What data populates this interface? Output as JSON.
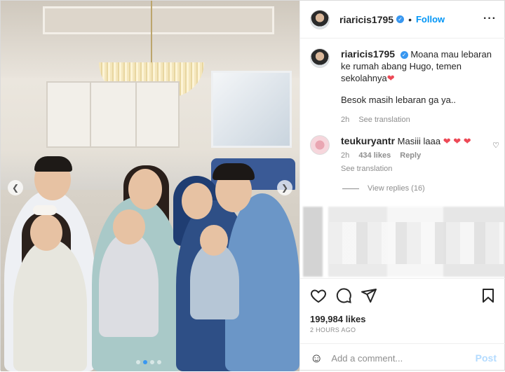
{
  "post": {
    "username": "riaricis1795",
    "verified_icon": "verified-badge-icon",
    "separator": "•",
    "follow_label": "Follow",
    "more_icon": "more-options-icon"
  },
  "photo": {
    "prev_icon": "chevron-left-icon",
    "next_icon": "chevron-right-icon",
    "carousel_total": 4,
    "carousel_active": 1
  },
  "caption": {
    "username": "riaricis1795",
    "line1": "Moana mau lebaran ke rumah abang Hugo, temen sekolahnya",
    "heart": "❤",
    "line2": "Besok masih lebaran ga ya..",
    "time": "2h",
    "translate": "See translation"
  },
  "comment": {
    "username": "teukuryantr",
    "text": "Masiii laaa",
    "hearts": "❤ ❤ ❤",
    "time": "2h",
    "likes": "434 likes",
    "reply": "Reply",
    "translate": "See translation",
    "view_replies": "View replies (16)"
  },
  "actions": {
    "like_icon": "heart-icon",
    "comment_icon": "comment-icon",
    "share_icon": "share-icon",
    "save_icon": "bookmark-icon",
    "likes": "199,984 likes",
    "time_ago": "2 HOURS AGO"
  },
  "add_comment": {
    "emoji_icon": "emoji-icon",
    "placeholder": "Add a comment...",
    "post_label": "Post"
  },
  "colors": {
    "accent": "#0095f6",
    "verified": "#3897f0",
    "heart": "#ed4956",
    "post_disabled": "#b3dbff"
  }
}
